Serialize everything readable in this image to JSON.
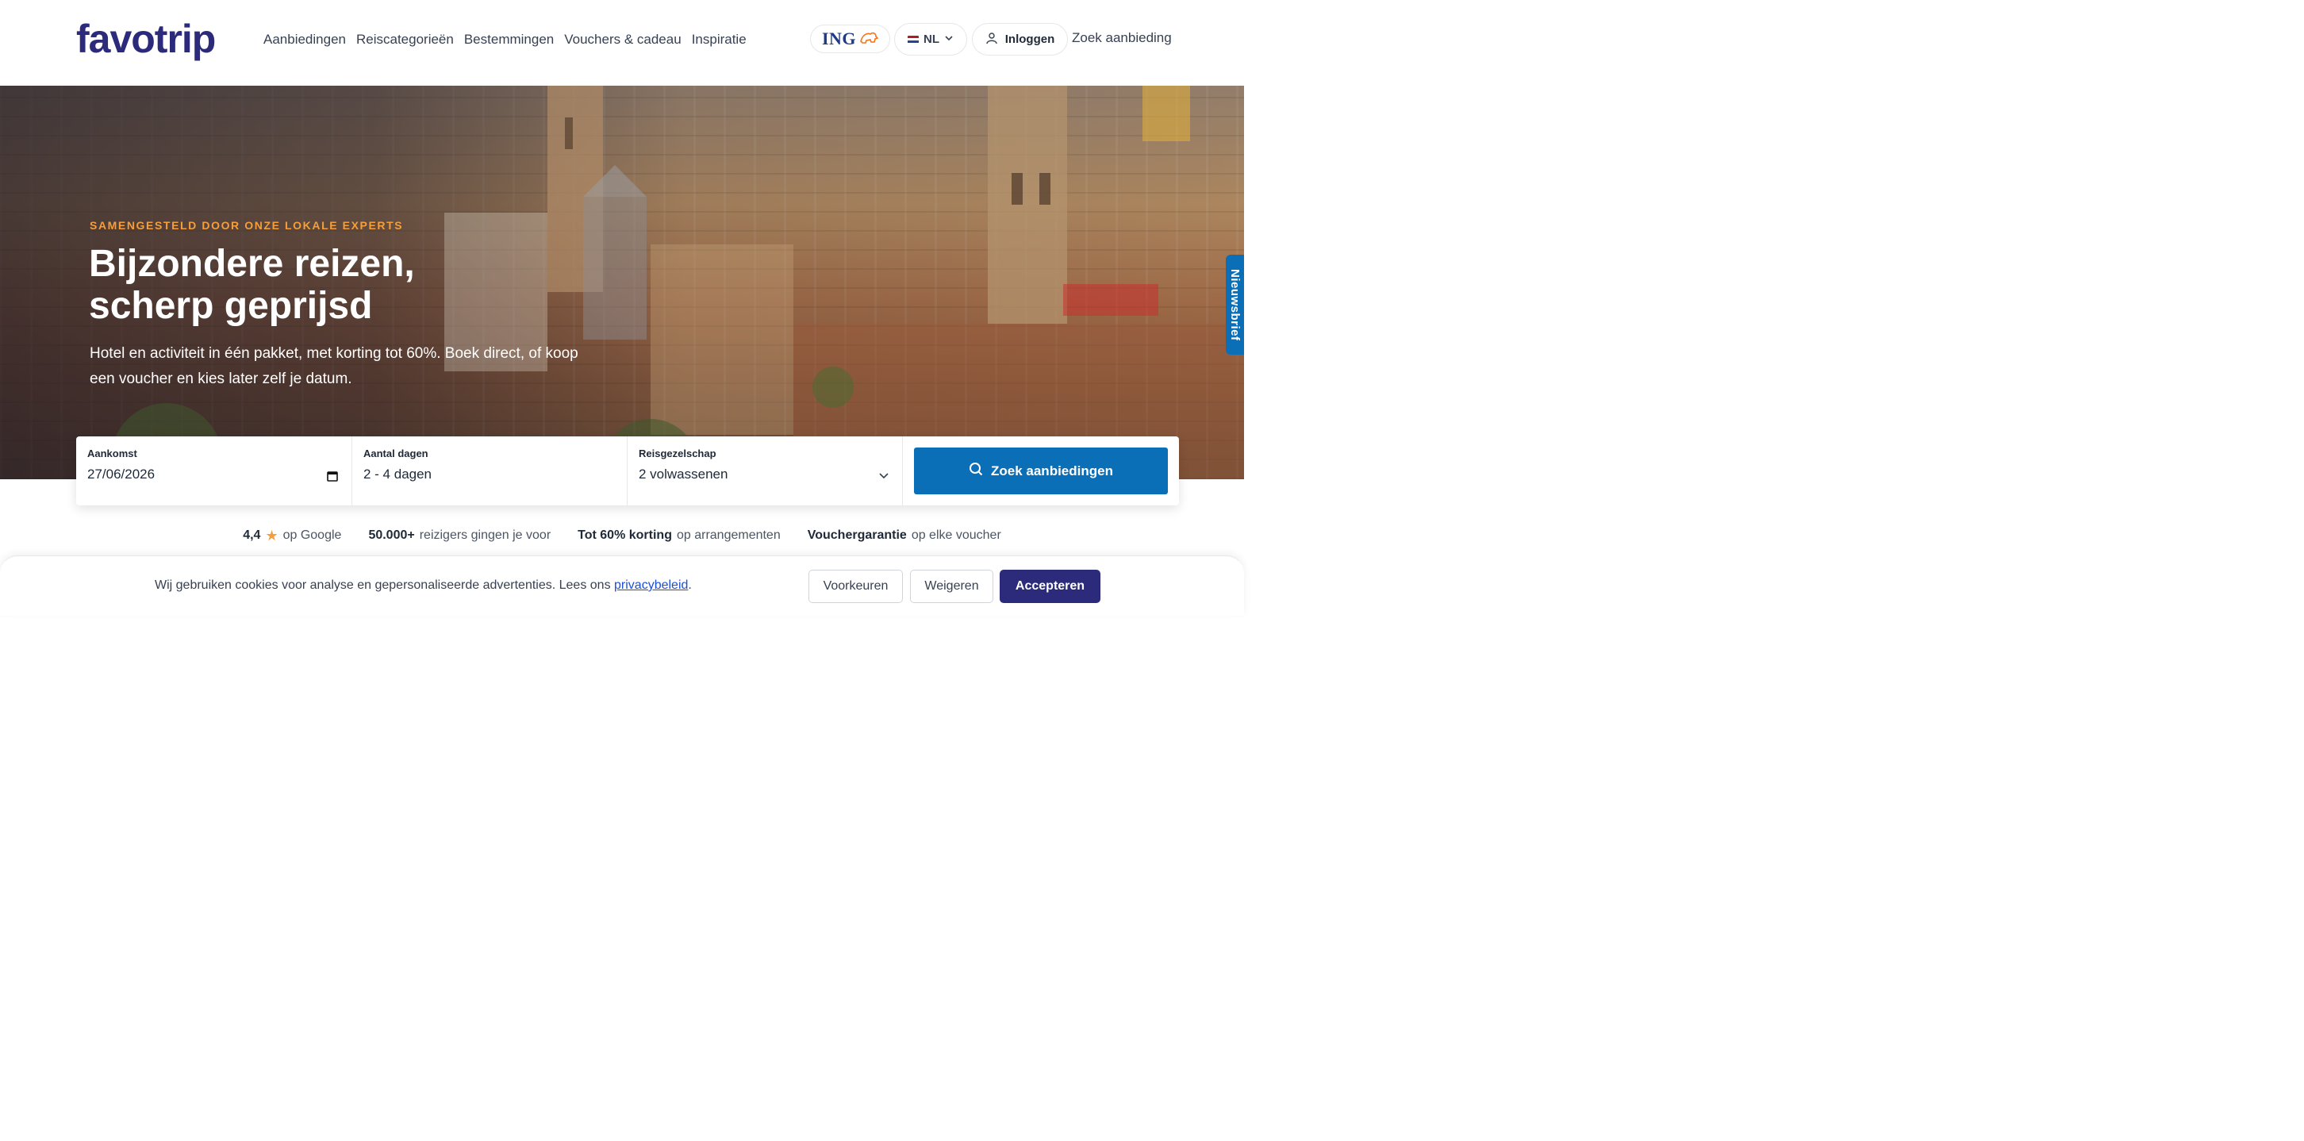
{
  "header": {
    "logo_text": "favotrip",
    "nav": [
      "Aanbiedingen",
      "Reiscategorieën",
      "Bestemmingen",
      "Vouchers & cadeau",
      "Inspiratie"
    ],
    "partner": "ING",
    "language": "NL",
    "login": "Inloggen",
    "search_link": "Zoek aanbieding"
  },
  "hero": {
    "eyebrow": "SAMENGESTELD DOOR ONZE LOKALE EXPERTS",
    "title_line1": "Bijzondere reizen,",
    "title_line2": "scherp geprijsd",
    "subtitle": "Hotel en activiteit in één pakket, met korting tot 60%. Boek direct, of koop een voucher en kies later zelf je datum."
  },
  "newsletter_tab": "Nieuwsbrief",
  "search": {
    "arrival_label": "Aankomst",
    "arrival_value": "27/06/2026",
    "days_label": "Aantal dagen",
    "days_value": "2 - 4 dagen",
    "company_label": "Reisgezelschap",
    "company_value": "2 volwassenen",
    "submit": "Zoek aanbiedingen"
  },
  "trust": {
    "rating_value": "4,4",
    "rating_suffix": "op Google",
    "travelers_value": "50.000+",
    "travelers_suffix": "reizigers gingen je voor",
    "discount_value": "Tot 60% korting",
    "discount_suffix": "op arrangementen",
    "voucher_value": "Vouchergarantie",
    "voucher_suffix": "op elke voucher"
  },
  "cookie": {
    "text": "Wij gebruiken cookies voor analyse en gepersonaliseerde advertenties. Lees ons",
    "link": "privacybeleid",
    "period": ".",
    "preferences": "Voorkeuren",
    "reject": "Weigeren",
    "accept": "Accepteren"
  },
  "colors": {
    "brand": "#2c2a7a",
    "primary": "#0b6fb8",
    "accent": "#f59e3b"
  }
}
